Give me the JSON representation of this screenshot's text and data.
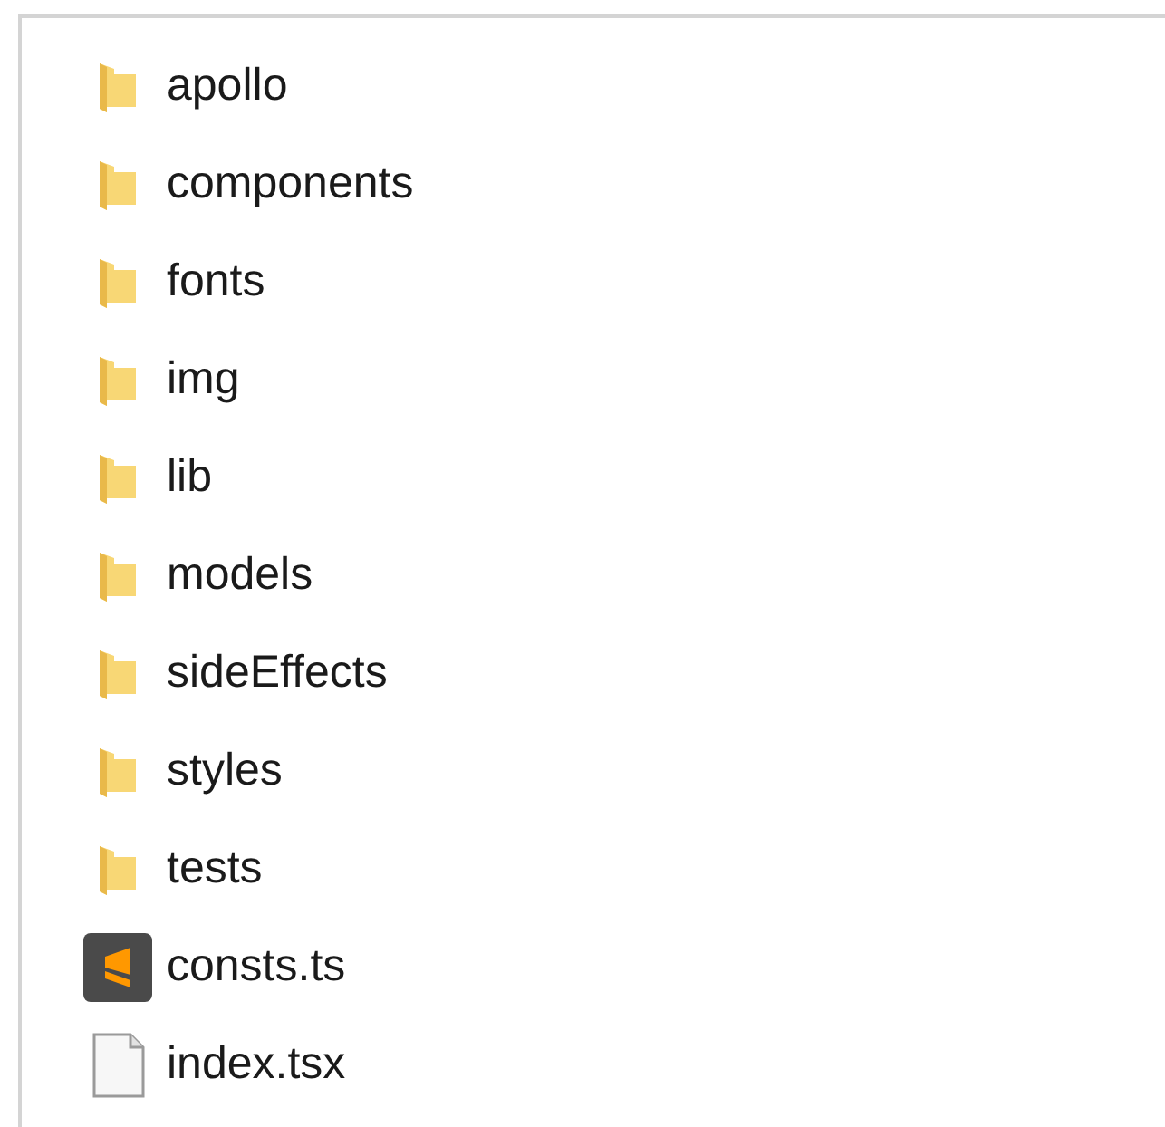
{
  "items": [
    {
      "name": "apollo",
      "kind": "folder"
    },
    {
      "name": "components",
      "kind": "folder"
    },
    {
      "name": "fonts",
      "kind": "folder"
    },
    {
      "name": "img",
      "kind": "folder"
    },
    {
      "name": "lib",
      "kind": "folder"
    },
    {
      "name": "models",
      "kind": "folder"
    },
    {
      "name": "sideEffects",
      "kind": "folder"
    },
    {
      "name": "styles",
      "kind": "folder"
    },
    {
      "name": "tests",
      "kind": "folder"
    },
    {
      "name": "consts.ts",
      "kind": "editor"
    },
    {
      "name": "index.tsx",
      "kind": "file"
    }
  ]
}
